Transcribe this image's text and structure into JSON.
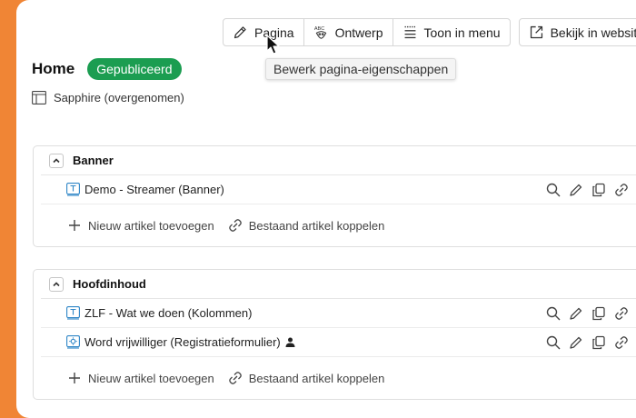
{
  "toolbar": {
    "group": [
      {
        "label": "Pagina",
        "icon": "pencil-icon"
      },
      {
        "label": "Ontwerp",
        "icon": "abc-design-icon"
      },
      {
        "label": "Toon in menu",
        "icon": "menu-lines-icon"
      }
    ],
    "view_website": {
      "label": "Bekijk in website",
      "icon": "external-link-icon"
    }
  },
  "tooltip": "Bewerk pagina-eigenschappen",
  "page": {
    "title": "Home",
    "status": "Gepubliceerd",
    "template": "Sapphire (overgenomen)"
  },
  "sections": [
    {
      "title": "Banner",
      "items": [
        {
          "label": "Demo - Streamer (Banner)",
          "icon": "text-block-icon"
        }
      ]
    },
    {
      "title": "Hoofdinhoud",
      "items": [
        {
          "label": "ZLF - Wat we doen (Kolommen)",
          "icon": "text-block-icon"
        },
        {
          "label": "Word vrijwilliger (Registratieformulier)",
          "icon": "form-icon"
        }
      ]
    }
  ],
  "footer_actions": {
    "add_new": "Nieuw artikel toevoegen",
    "link_existing": "Bestaand artikel koppelen"
  },
  "colors": {
    "accent": "#f08535",
    "published_badge": "#1b9d51",
    "item_icon": "#2f86c7"
  }
}
